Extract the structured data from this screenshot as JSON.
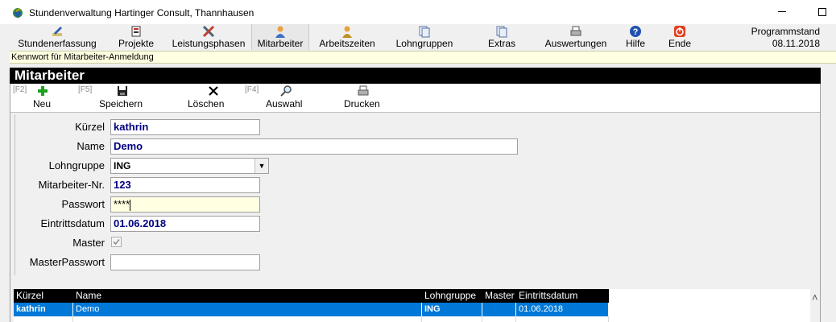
{
  "window": {
    "title": "Stundenverwaltung Hartinger Consult, Thannhausen"
  },
  "toolbar": {
    "items": [
      {
        "label": "Stundenerfassung",
        "icon": "pencil-icon"
      },
      {
        "label": "Projekte",
        "icon": "projects-icon"
      },
      {
        "label": "Leistungsphasen",
        "icon": "tools-icon"
      },
      {
        "label": "Mitarbeiter",
        "icon": "person-icon"
      },
      {
        "label": "Arbeitszeiten",
        "icon": "person-clock-icon"
      },
      {
        "label": "Lohngruppen",
        "icon": "documents-icon"
      },
      {
        "label": "Extras",
        "icon": "documents-icon"
      },
      {
        "label": "Auswertungen",
        "icon": "printer-icon"
      },
      {
        "label": "Hilfe",
        "icon": "help-icon"
      },
      {
        "label": "Ende",
        "icon": "power-icon"
      }
    ],
    "program_state_label": "Programmstand",
    "program_state_date": "08.11.2018"
  },
  "hint": "Kennwort für Mitarbeiter-Anmeldung",
  "panel": {
    "title": "Mitarbeiter",
    "actions": [
      {
        "key": "[F2]",
        "label": "Neu",
        "icon": "plus-icon"
      },
      {
        "key": "[F5]",
        "label": "Speichern",
        "icon": "floppy-icon"
      },
      {
        "key": "",
        "label": "Löschen",
        "icon": "x-icon"
      },
      {
        "key": "[F4]",
        "label": "Auswahl",
        "icon": "magnifier-icon"
      },
      {
        "key": "",
        "label": "Drucken",
        "icon": "printer-icon"
      }
    ]
  },
  "form": {
    "kuerzel": {
      "label": "Kürzel",
      "value": "kathrin"
    },
    "name": {
      "label": "Name",
      "value": "Demo"
    },
    "lohngruppe": {
      "label": "Lohngruppe",
      "value": "ING"
    },
    "nr": {
      "label": "Mitarbeiter-Nr.",
      "value": "123"
    },
    "passwort": {
      "label": "Passwort",
      "value": "****"
    },
    "eintritt": {
      "label": "Eintrittsdatum",
      "value": "01.06.2018"
    },
    "master": {
      "label": "Master",
      "checked": true
    },
    "masterpw": {
      "label": "MasterPasswort",
      "value": ""
    }
  },
  "table": {
    "headers": [
      "Kürzel",
      "Name",
      "Lohngruppe",
      "Master",
      "Eintrittsdatum"
    ],
    "rows": [
      [
        "kathrin",
        "Demo",
        "ING",
        "",
        "01.06.2018"
      ]
    ]
  },
  "colors": {
    "selection": "#0078d7",
    "header": "#000000",
    "hint_bg": "#ffffe1",
    "value_text": "#000080"
  }
}
